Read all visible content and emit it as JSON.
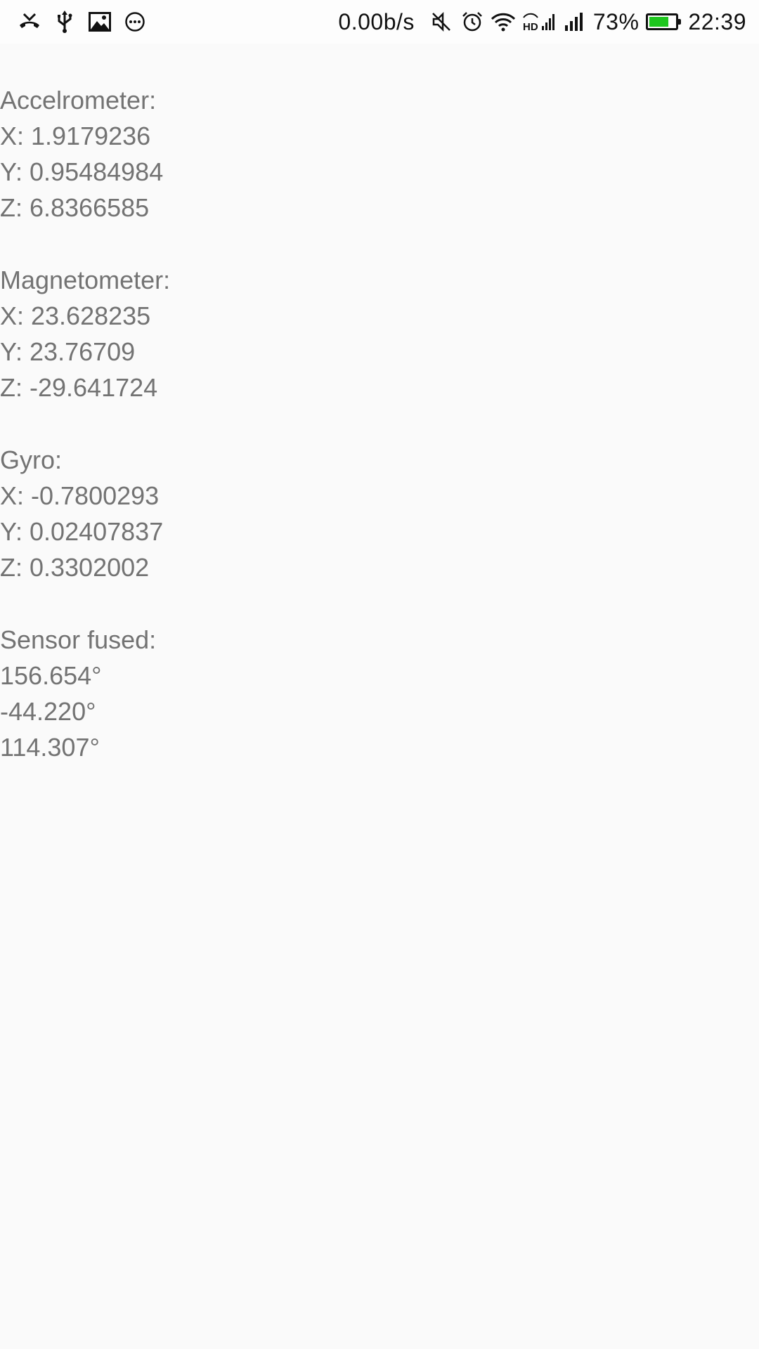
{
  "status_bar": {
    "net_speed": "0.00b/s",
    "battery_percent": "73%",
    "battery_level": 0.73,
    "battery_color": "#1ec61e",
    "time": "22:39",
    "left_icons": [
      "missed-call-icon",
      "usb-icon",
      "image-icon",
      "more-dots-icon"
    ],
    "right_icons": [
      "mute-icon",
      "alarm-icon",
      "wifi-icon",
      "hd-signal-icon",
      "signal-icon",
      "battery-icon"
    ]
  },
  "accelerometer": {
    "title": "Accelrometer:",
    "x": "X: 1.9179236",
    "y": "Y: 0.95484984",
    "z": "Z: 6.8366585"
  },
  "magnetometer": {
    "title": "Magnetometer:",
    "x": "X: 23.628235",
    "y": "Y: 23.76709",
    "z": "Z: -29.641724"
  },
  "gyro": {
    "title": "Gyro:",
    "x": "X: -0.7800293",
    "y": "Y: 0.02407837",
    "z": "Z: 0.3302002"
  },
  "sensor_fused": {
    "title": "Sensor fused:",
    "a": "156.654°",
    "b": "-44.220°",
    "c": "114.307°"
  }
}
